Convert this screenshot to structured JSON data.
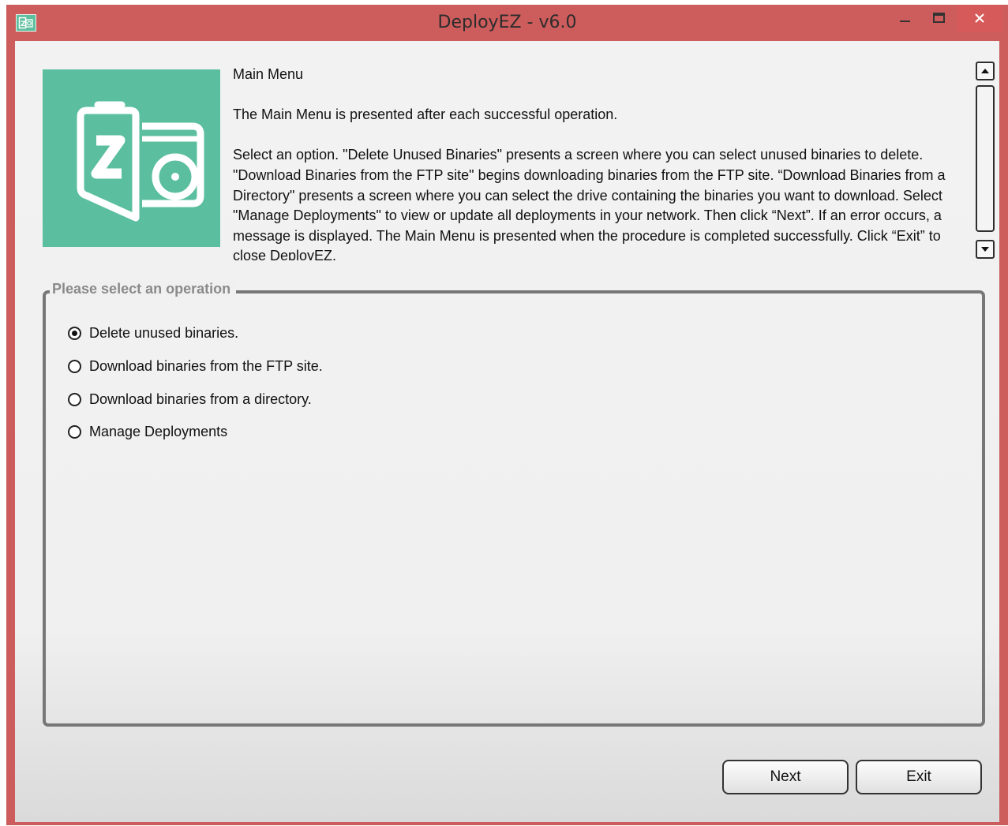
{
  "window": {
    "title": "DeployEZ - v6.0",
    "accent_color": "#cd5c5c",
    "logo_color": "#5bbf9f",
    "controls": [
      "minimize-icon",
      "maximize-icon",
      "close-icon"
    ]
  },
  "help": {
    "heading": "Main Menu",
    "paragraph1": "The Main Menu is presented after each successful operation.",
    "paragraph2": "Select an option. \"Delete Unused Binaries\" presents a screen where you can select unused binaries to delete. \"Download Binaries from the FTP site\" begins downloading binaries from the FTP site. “Download Binaries from a Directory\" presents a screen where you can select the drive containing the binaries you want to download. Select \"Manage Deployments\" to view or update all deployments in your network. Then click “Next”. If an error occurs, a message is displayed. The Main Menu is presented when the procedure is completed successfully. Click “Exit” to close DeployEZ."
  },
  "operations": {
    "legend": "Please select an operation",
    "selected_index": 0,
    "options": [
      {
        "label": "Delete unused binaries."
      },
      {
        "label": "Download binaries from the FTP site."
      },
      {
        "label": "Download binaries from a directory."
      },
      {
        "label": "Manage Deployments"
      }
    ]
  },
  "buttons": {
    "next_label": "Next",
    "exit_label": "Exit"
  }
}
